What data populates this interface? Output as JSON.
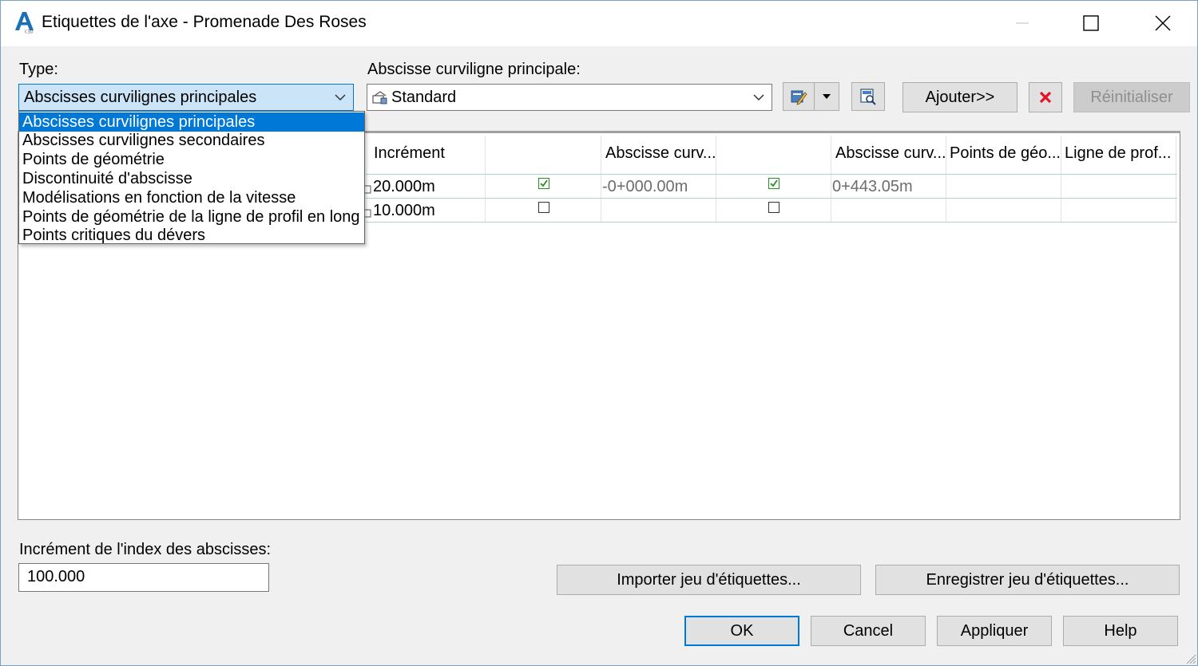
{
  "window": {
    "title": "Etiquettes de l'axe - Promenade Des Roses",
    "app_icon": "autocad-civil-icon"
  },
  "type_field": {
    "label": "Type:",
    "selected": "Abscisses curvilignes principales",
    "options": [
      "Abscisses curvilignes principales",
      "Abscisses curvilignes secondaires",
      "Points de géométrie",
      "Discontinuité d'abscisse",
      "Modélisations en fonction de la vitesse",
      "Points de géométrie de la ligne de profil en long",
      "Points critiques du dévers"
    ]
  },
  "style_field": {
    "label": "Abscisse curviligne principale:",
    "selected": "Standard"
  },
  "toolbar": {
    "add_label": "Ajouter>>",
    "reset_label": "Réinitialiser"
  },
  "grid": {
    "headers": [
      "Incrément",
      "",
      "Abscisse curv...",
      "",
      "Abscisse curv...",
      "Points de géo...",
      "Ligne de prof..."
    ],
    "rows": [
      {
        "increment": "20.000m",
        "start_checked": true,
        "start_value": "-0+000.00m",
        "end_checked": true,
        "end_value": "0+443.05m"
      },
      {
        "increment": "10.000m",
        "start_checked": false,
        "start_value": "",
        "end_checked": false,
        "end_value": ""
      }
    ]
  },
  "index_increment": {
    "label": "Incrément de l'index des abscisses:",
    "value": "100.000"
  },
  "buttons": {
    "import": "Importer jeu d'étiquettes...",
    "save": "Enregistrer jeu d'étiquettes...",
    "ok": "OK",
    "cancel": "Cancel",
    "apply": "Appliquer",
    "help": "Help"
  },
  "colors": {
    "accent": "#0078d7",
    "delete": "#e81123",
    "check": "#2a8a2a"
  }
}
